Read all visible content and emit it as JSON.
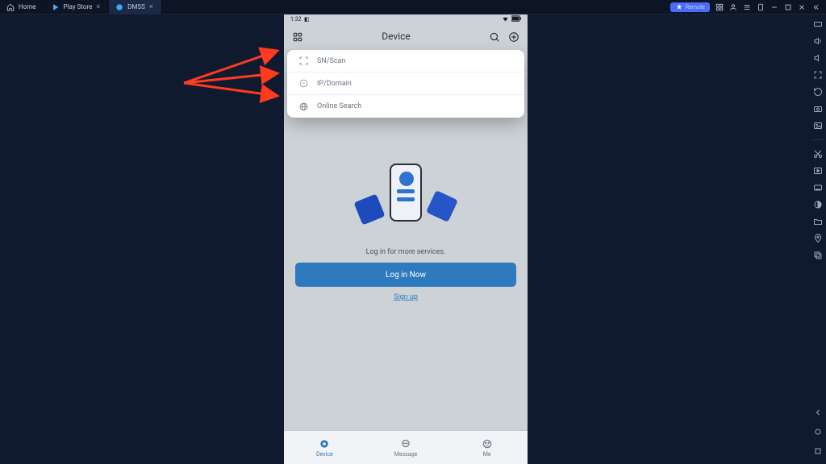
{
  "tabs": {
    "home": {
      "label": "Home"
    },
    "play": {
      "label": "Play Store"
    },
    "dmss": {
      "label": "DMSS"
    }
  },
  "window": {
    "remote_label": "Remote"
  },
  "status": {
    "time": "1:32"
  },
  "app": {
    "title": "Device",
    "login_hint": "Log in for more services.",
    "login_btn": "Log in Now",
    "signup": "Sign up"
  },
  "popover": {
    "items": [
      {
        "label": "SN/Scan"
      },
      {
        "label": "IP/Domain"
      },
      {
        "label": "Online Search"
      }
    ]
  },
  "bottom": {
    "items": [
      {
        "label": "Device"
      },
      {
        "label": "Message"
      },
      {
        "label": "Me"
      }
    ]
  },
  "colors": {
    "accent": "#2e7abf",
    "remote": "#4a6bff",
    "arrow": "#ff3b1f"
  }
}
